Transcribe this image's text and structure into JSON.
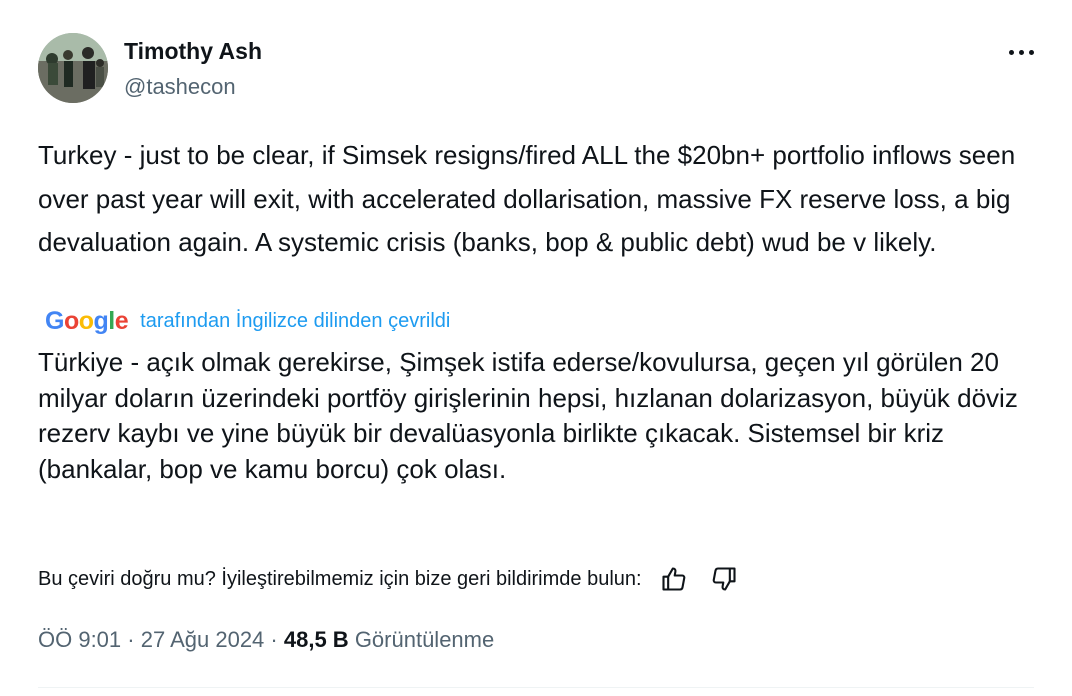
{
  "author": {
    "name": "Timothy Ash",
    "handle": "@tashecon"
  },
  "tweet": {
    "text": "Turkey - just to be clear, if Simsek resigns/fired ALL the $20bn+ portfolio inflows seen over past year will exit, with accelerated dollarisation, massive FX reserve loss, a big devaluation again. A systemic crisis (banks, bop & public debt) wud be v likely."
  },
  "translation": {
    "provider": "Google",
    "label": "tarafından İngilizce dilinden çevrildi",
    "text": "Türkiye - açık olmak gerekirse, Şimşek istifa ederse/kovulursa, geçen yıl görülen 20 milyar doların üzerindeki portföy girişlerinin hepsi, hızlanan dolarizasyon, büyük döviz rezerv kaybı ve yine büyük bir devalüasyonla birlikte çıkacak. Sistemsel bir kriz (bankalar, bop ve kamu borcu) çok olası."
  },
  "feedback": {
    "prompt": "Bu çeviri doğru mu? İyileştirebilmemiz için bize geri bildirimde bulun:",
    "thumbs_up_icon": "thumbs-up-icon",
    "thumbs_down_icon": "thumbs-down-icon"
  },
  "meta": {
    "time": "ÖÖ 9:01",
    "separator": " · ",
    "date": "27 Ağu 2024",
    "views_count": "48,5 B",
    "views_label": "Görüntülenme"
  },
  "icons": {
    "more": "more-options-icon"
  },
  "colors": {
    "text": "#0f1419",
    "secondary": "#536471",
    "link": "#1d9bf0"
  }
}
